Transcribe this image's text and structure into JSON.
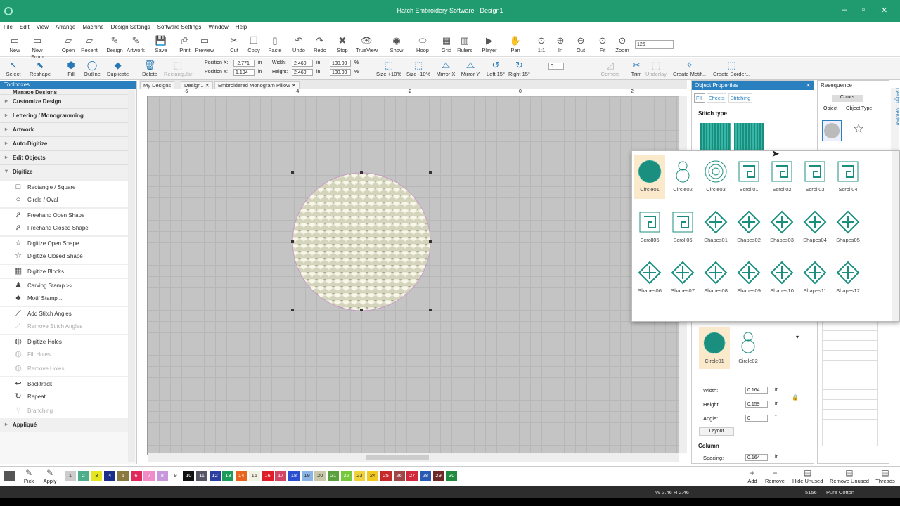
{
  "window": {
    "title": "Hatch Embroidery Software - Design1"
  },
  "menu": [
    "File",
    "Edit",
    "View",
    "Arrange",
    "Machine",
    "Design Settings",
    "Software Settings",
    "Window",
    "Help"
  ],
  "toolbar1": [
    "New",
    "New From",
    "Open",
    "Recent",
    "Design",
    "Artwork",
    "Save",
    "Print",
    "Preview",
    "Cut",
    "Copy",
    "Paste",
    "Undo",
    "Redo",
    "Stop",
    "TrueView",
    "Show",
    "Hoop",
    "Grid",
    "Rulers",
    "Player",
    "Pan",
    "1:1",
    "In",
    "Out",
    "Fit",
    "Zoom"
  ],
  "zoom_value": "125",
  "toolbar2": {
    "select": "Select",
    "reshape": "Reshape",
    "fill": "Fill",
    "outline": "Outline",
    "duplicate": "Duplicate",
    "delete": "Delete",
    "rectangular": "Rectangular",
    "pos_x_label": "Position X:",
    "pos_y_label": "Position Y:",
    "pos_x": "-2.771",
    "pos_y": "1.194",
    "width_label": "Width:",
    "height_label": "Height:",
    "width": "2.460",
    "height": "2.460",
    "unit": "in",
    "pct_w": "100.00",
    "pct_h": "100.00",
    "pct": "%",
    "size_plus": "Size +10%",
    "size_minus": "Size -10%",
    "mirror_x": "Mirror X",
    "mirror_y": "Mirror Y",
    "left15": "Left 15°",
    "right15": "Right 15°",
    "angle": "0",
    "corners": "Corners",
    "trim": "Trim",
    "underlay": "Underlay",
    "create_motif": "Create Motif...",
    "create_border": "Create Border..."
  },
  "toolboxes": {
    "title": "Toolboxes",
    "items": [
      {
        "type": "sec",
        "label": "Manage Designs"
      },
      {
        "type": "sec",
        "label": "Customize Design"
      },
      {
        "type": "sec",
        "label": "Lettering / Monogramming"
      },
      {
        "type": "sec",
        "label": "Artwork"
      },
      {
        "type": "sec",
        "label": "Auto-Digitize"
      },
      {
        "type": "sec",
        "label": "Edit Objects"
      },
      {
        "type": "secopen",
        "label": "Digitize"
      },
      {
        "type": "item",
        "label": "Rectangle / Square",
        "icon": "□"
      },
      {
        "type": "item",
        "label": "Circle / Oval",
        "icon": "○"
      },
      {
        "type": "item",
        "label": "Freehand Open Shape",
        "icon": "ዖ"
      },
      {
        "type": "item",
        "label": "Freehand Closed Shape",
        "icon": "ዖ"
      },
      {
        "type": "item",
        "label": "Digitize Open Shape",
        "icon": "☆"
      },
      {
        "type": "item",
        "label": "Digitize Closed Shape",
        "icon": "☆"
      },
      {
        "type": "item",
        "label": "Digitize Blocks",
        "icon": "▦"
      },
      {
        "type": "item",
        "label": "Carving Stamp >>",
        "icon": "♟"
      },
      {
        "type": "item",
        "label": "Motif Stamp...",
        "icon": "♣"
      },
      {
        "type": "item",
        "label": "Add Stitch Angles",
        "icon": "⟋"
      },
      {
        "type": "itemdis",
        "label": "Remove Stitch Angles",
        "icon": "⟋"
      },
      {
        "type": "item",
        "label": "Digitize Holes",
        "icon": "◍"
      },
      {
        "type": "itemdis",
        "label": "Fill Holes",
        "icon": "◍"
      },
      {
        "type": "itemdis",
        "label": "Remove Holes",
        "icon": "◍"
      },
      {
        "type": "item",
        "label": "Backtrack",
        "icon": "↩"
      },
      {
        "type": "item",
        "label": "Repeat",
        "icon": "↻"
      },
      {
        "type": "itemdis",
        "label": "Branching",
        "icon": "⑂"
      },
      {
        "type": "sec",
        "label": "Appliqué"
      }
    ]
  },
  "tabs": [
    "My Designs",
    "Design1",
    "Embroidered Monogram Pillow"
  ],
  "ruler_labels": [
    "-6",
    "-4",
    "-2",
    "0",
    "2"
  ],
  "object_properties": {
    "title": "Object Properties",
    "tabs": [
      "Fill",
      "Effects",
      "Stitching"
    ],
    "stitch_type": "Stitch type",
    "patterns": [
      "Circle01",
      "Circle02"
    ],
    "width_label": "Width:",
    "width": "0.164",
    "height_label": "Height:",
    "height": "0.159",
    "angle_label": "Angle:",
    "angle": "0",
    "unit": "in",
    "deg": "°",
    "layout": "Layout",
    "column": "Column",
    "spacing_label": "Spacing:",
    "spacing": "0.164"
  },
  "resequence": {
    "title": "Resequence",
    "colors": "Colors",
    "object": "Object",
    "object_type": "Object Type",
    "side": "Design Overview"
  },
  "pattern_popup": [
    "Circle01",
    "Circle02",
    "Circle03",
    "Scroll01",
    "Scroll02",
    "Scroll03",
    "Scroll04",
    "Scroll05",
    "Scroll06",
    "Shapes01",
    "Shapes02",
    "Shapes03",
    "Shapes04",
    "Shapes05",
    "Shapes06",
    "Shapes07",
    "Shapes08",
    "Shapes09",
    "Shapes10",
    "Shapes11",
    "Shapes12"
  ],
  "colorbar": {
    "pick": "Pick",
    "apply": "Apply",
    "swatches": [
      {
        "n": "1",
        "c": "#cccccc"
      },
      {
        "n": "2",
        "c": "#4caf8a"
      },
      {
        "n": "3",
        "c": "#e6e61e"
      },
      {
        "n": "4",
        "c": "#1b2f8a"
      },
      {
        "n": "5",
        "c": "#8a7a40"
      },
      {
        "n": "6",
        "c": "#e0285a"
      },
      {
        "n": "7",
        "c": "#f08cc8"
      },
      {
        "n": "8",
        "c": "#c896dc"
      },
      {
        "n": "9",
        "c": "#ffffff"
      },
      {
        "n": "10",
        "c": "#111111"
      },
      {
        "n": "11",
        "c": "#555566"
      },
      {
        "n": "12",
        "c": "#2a3fa0"
      },
      {
        "n": "13",
        "c": "#1c9c5a"
      },
      {
        "n": "14",
        "c": "#e8641e"
      },
      {
        "n": "15",
        "c": "#f2f0e0"
      },
      {
        "n": "16",
        "c": "#e01e28"
      },
      {
        "n": "17",
        "c": "#d24664"
      },
      {
        "n": "18",
        "c": "#2a4fd0"
      },
      {
        "n": "19",
        "c": "#8ab4e6"
      },
      {
        "n": "20",
        "c": "#c8c8aa"
      },
      {
        "n": "21",
        "c": "#5aa03c"
      },
      {
        "n": "22",
        "c": "#78c83c"
      },
      {
        "n": "23",
        "c": "#f0d23c"
      },
      {
        "n": "24",
        "c": "#f0c81e"
      },
      {
        "n": "25",
        "c": "#c82828"
      },
      {
        "n": "26",
        "c": "#a04646"
      },
      {
        "n": "27",
        "c": "#d2283c"
      },
      {
        "n": "28",
        "c": "#2a5ab4"
      },
      {
        "n": "29",
        "c": "#6e2828"
      },
      {
        "n": "30",
        "c": "#1e8c3c"
      }
    ],
    "add": "Add",
    "remove": "Remove",
    "hide_unused": "Hide Unused",
    "remove_unused": "Remove Unused",
    "threads": "Threads"
  },
  "status": {
    "dims": "W 2.46 H 2.46",
    "count": "5156",
    "thread": "Pure Cotton"
  }
}
